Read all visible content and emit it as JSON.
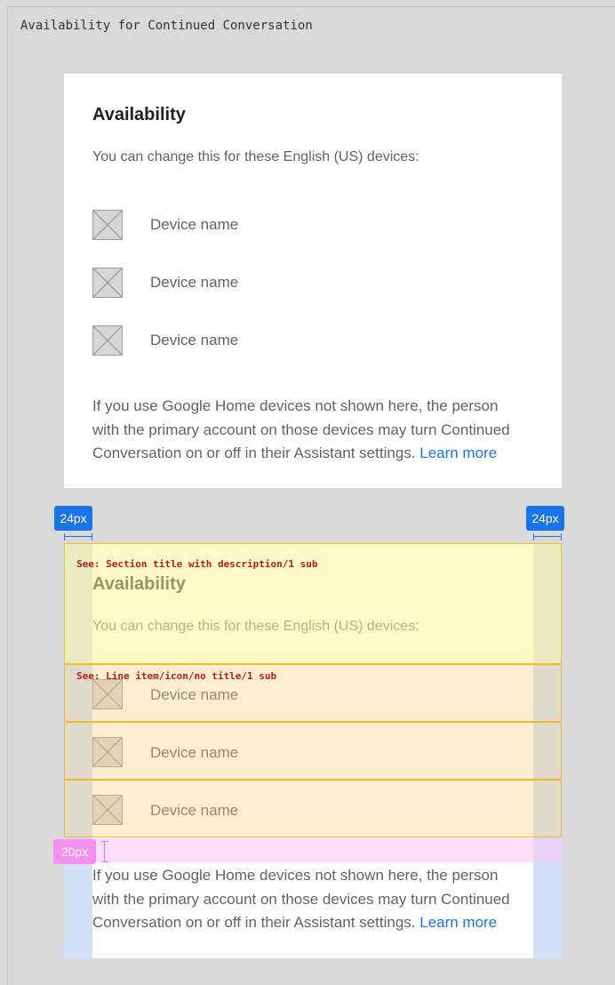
{
  "frame": {
    "title": "Availability for Continued Conversation"
  },
  "card": {
    "title": "Availability",
    "description": "You can change this for these English (US) devices:",
    "devices": [
      {
        "name": "Device name",
        "icon": "image-placeholder-icon"
      },
      {
        "name": "Device name",
        "icon": "image-placeholder-icon"
      },
      {
        "name": "Device name",
        "icon": "image-placeholder-icon"
      }
    ],
    "footer_text": "If you use Google Home devices not shown here, the person with the primary account on those devices may turn Continued Conversation on or off in their Assistant settings.",
    "footer_link": "Learn more"
  },
  "annotations": {
    "padding_left_label": "24px",
    "padding_right_label": "24px",
    "gap_label": "20px",
    "section_ref": "See: Section title with description/1 sub",
    "line_item_ref": "See: Line item/icon/no title/1 sub"
  },
  "colors": {
    "background": "#d9d9d9",
    "card": "#ffffff",
    "title_text": "#202124",
    "body_text": "#5f6368",
    "link": "#1a73e8",
    "measure_blue": "#1a73e8",
    "measure_pink": "#f58ff0",
    "section_overlay": "#fff496",
    "line_overlay": "#fbcd78"
  }
}
